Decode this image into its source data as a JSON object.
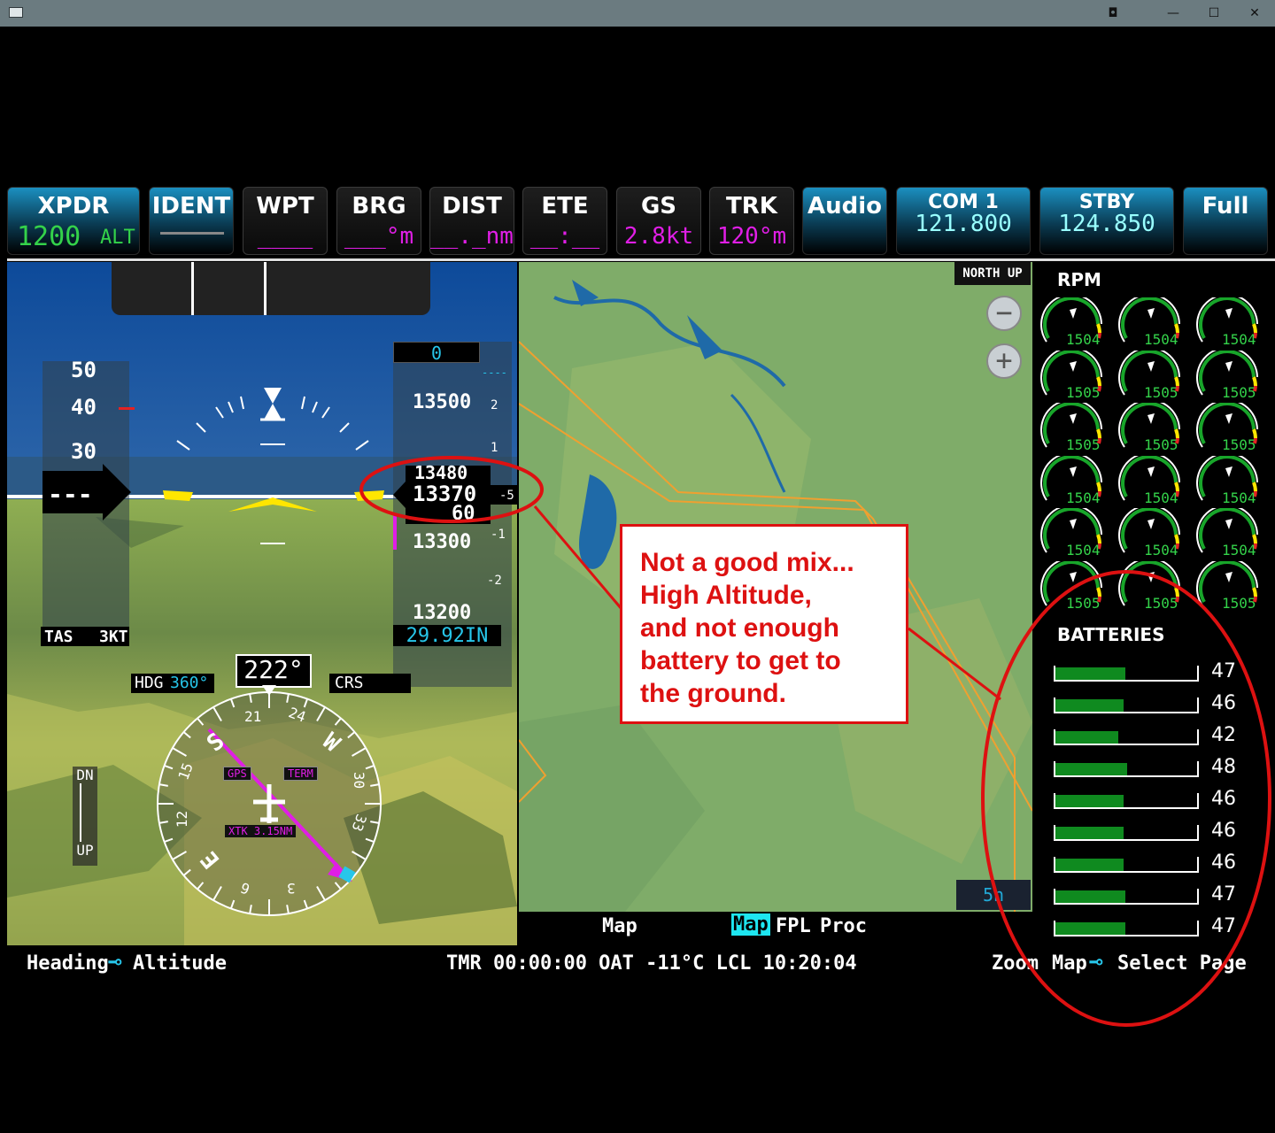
{
  "window": {
    "buttons": [
      "◘",
      "—",
      "☐",
      "✕"
    ]
  },
  "softkeys": [
    {
      "label": "XPDR",
      "value": "1200",
      "suffix": "ALT",
      "style": "blue"
    },
    {
      "label": "IDENT",
      "value": "",
      "style": "blue"
    },
    {
      "label": "WPT",
      "value": "____",
      "style": "dark"
    },
    {
      "label": "BRG",
      "value": "___°m",
      "style": "dark"
    },
    {
      "label": "DIST",
      "value": "__._nm",
      "style": "dark"
    },
    {
      "label": "ETE",
      "value": "__:__",
      "style": "dark"
    },
    {
      "label": "GS",
      "value": "2.8kt",
      "style": "dark"
    },
    {
      "label": "TRK",
      "value": "120°m",
      "style": "dark"
    },
    {
      "label": "Audio",
      "value": "",
      "style": "blue"
    },
    {
      "label": "COM 1",
      "value": "121.800",
      "style": "blue"
    },
    {
      "label": "STBY",
      "value": "124.850",
      "style": "blue"
    },
    {
      "label": "Full",
      "value": "",
      "style": "blue"
    }
  ],
  "pfd": {
    "airspeed_ticks": [
      "50",
      "40",
      "30"
    ],
    "airspeed_readout": "---",
    "tas_label": "TAS",
    "tas_value": "3KT",
    "altitude_ticks": [
      "13500",
      "13300",
      "13200"
    ],
    "altitude_selected": "0",
    "altitude_readout_top": "13480",
    "altitude_readout_main": "13370",
    "altitude_readout_bottom": "60",
    "vs_ticks": [
      "2",
      "1",
      "-1",
      "-2"
    ],
    "vs_readout": "-5",
    "selected_alt_dashes": "----",
    "baro": "29.92IN",
    "heading_label": "HDG",
    "heading_bug": "360°",
    "heading_current": "222°",
    "crs_label": "CRS",
    "compass_labels": [
      "21",
      "24",
      "W",
      "30",
      "33",
      "3",
      "6",
      "E",
      "12",
      "15",
      "S"
    ],
    "gps_label": "GPS",
    "term_label": "TERM",
    "xtk_label": "XTK 3.15NM",
    "vs_dn": "DN",
    "vs_up": "UP"
  },
  "map": {
    "orientation": "NORTH UP",
    "zoom_out": "−",
    "zoom_in": "+",
    "scale": "5n",
    "tabs": [
      "Map",
      "Map",
      "FPL",
      "Proc"
    ],
    "active_tab_index": 1
  },
  "rpm": {
    "title": "RPM",
    "values": [
      "1504",
      "1504",
      "1504",
      "1505",
      "1505",
      "1505",
      "1505",
      "1505",
      "1505",
      "1504",
      "1504",
      "1504",
      "1504",
      "1504",
      "1504",
      "1505",
      "1505",
      "1505"
    ]
  },
  "batteries": {
    "title": "BATTERIES",
    "values": [
      47,
      46,
      42,
      48,
      46,
      46,
      46,
      47,
      47
    ]
  },
  "status_bar": {
    "left_a": "Heading",
    "left_b": "Altitude",
    "center": "TMR 00:00:00 OAT -11°C LCL 10:20:04",
    "right_a": "Zoom",
    "right_b": "Map",
    "right_c": "Select Page"
  },
  "callout": {
    "lines": [
      "Not a good mix...",
      "High Altitude,",
      "and not enough",
      "battery to get to",
      "the ground."
    ]
  },
  "colors": {
    "annotation": "#dd1111",
    "magenta": "#e01ee6",
    "green": "#34d24a",
    "cyan": "#27c6ea"
  }
}
